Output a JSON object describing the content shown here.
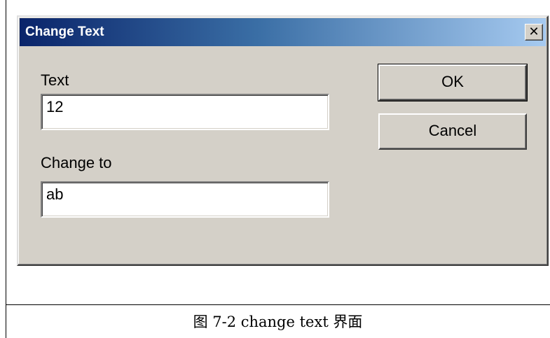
{
  "dialog": {
    "title": "Change Text",
    "close_glyph": "✕",
    "close_icon": "close-icon",
    "text_label": "Text",
    "text_value": "12",
    "change_to_label": "Change to",
    "change_to_value": "ab",
    "ok_label": "OK",
    "cancel_label": "Cancel",
    "colors": {
      "face": "#d4d0c8",
      "title_gradient_start": "#0a246a",
      "title_gradient_end": "#a6caf0"
    }
  },
  "caption": "图 7-2 change text 界面"
}
